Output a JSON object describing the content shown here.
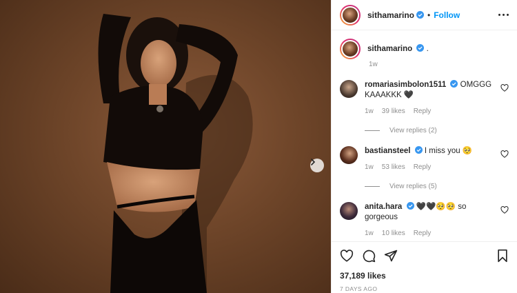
{
  "post": {
    "username": "sithamarino",
    "separator": "•",
    "follow_label": "Follow",
    "caption": ".",
    "caption_time": "1w",
    "likes": "37,189 likes",
    "time_ago": "7 DAYS AGO"
  },
  "comments": [
    {
      "username": "romariasimbolon1511",
      "text": "OMGGG KAAAKKK 🖤",
      "time": "1w",
      "likes": "39 likes",
      "reply_label": "Reply",
      "view_replies": "View replies (2)"
    },
    {
      "username": "bastiansteel",
      "text": "I miss you 🥺",
      "time": "1w",
      "likes": "53 likes",
      "reply_label": "Reply",
      "view_replies": "View replies (5)"
    },
    {
      "username": "anita.hara",
      "text": "🖤🖤🥺🥺 so gorgeous",
      "time": "1w",
      "likes": "10 likes",
      "reply_label": "Reply"
    }
  ],
  "icons": {
    "verified": "verified-badge-icon",
    "more": "more-options-icon",
    "next": "chevron-right-icon",
    "like": "heart-icon",
    "comment": "comment-icon",
    "share": "share-icon",
    "save": "bookmark-icon"
  },
  "colors": {
    "accent": "#0095f6",
    "verified": "#3897f0",
    "muted": "#8e8e8e",
    "text": "#262626"
  }
}
